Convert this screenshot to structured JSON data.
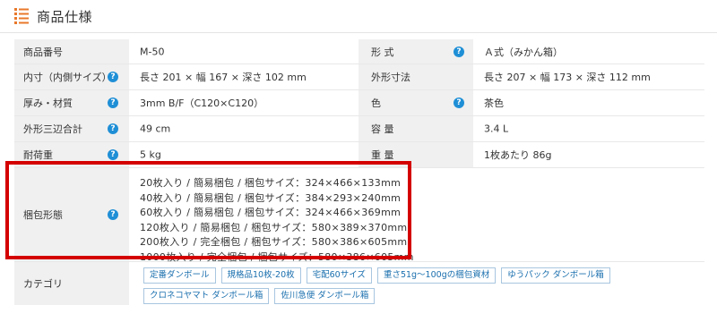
{
  "header": {
    "title": "商品仕様"
  },
  "specs": {
    "rows": [
      {
        "l1": "商品番号",
        "v1": "M-50",
        "l2": "形 式",
        "v2": "Ａ式（みかん箱）"
      },
      {
        "l1": "内寸（内側サイズ）",
        "v1": "長さ 201 × 幅 167 × 深さ 102 mm",
        "l2": "外形寸法",
        "v2": "長さ 207 × 幅 173 × 深さ 112 mm"
      },
      {
        "l1": "厚み・材質",
        "v1": "3mm B/F（C120×C120）",
        "l2": "色",
        "v2": "茶色"
      },
      {
        "l1": "外形三辺合計",
        "v1": "49 cm",
        "l2": "容 量",
        "v2": "3.4 L"
      },
      {
        "l1": "耐荷重",
        "v1": "5 kg",
        "l2": "重 量",
        "v2": "1枚あたり 86g"
      }
    ],
    "packing": {
      "label": "梱包形態",
      "lines": [
        "20枚入り / 簡易梱包 / 梱包サイズ：324×466×133mm",
        "40枚入り / 簡易梱包 / 梱包サイズ：384×293×240mm",
        "60枚入り / 簡易梱包 / 梱包サイズ：324×466×369mm",
        "120枚入り / 簡易梱包 / 梱包サイズ：580×389×370mm",
        "200枚入り / 完全梱包 / 梱包サイズ：580×386×605mm",
        "1000枚入り / 完全梱包 / 梱包サイズ：580×386×605mm"
      ]
    },
    "category": {
      "label": "カテゴリ",
      "tags": [
        "定番ダンボール",
        "規格品10枚-20枚",
        "宅配60サイズ",
        "重さ51g〜100gの梱包資材",
        "ゆうパック ダンボール箱",
        "クロネコヤマト ダンボール箱",
        "佐川急便 ダンボール箱"
      ]
    }
  },
  "colors": {
    "accent": "#e8782a",
    "help_icon": "#1f8fd6",
    "highlight": "#d40000",
    "label_bg": "#f0f0f0",
    "tag_text": "#1a6fae"
  }
}
